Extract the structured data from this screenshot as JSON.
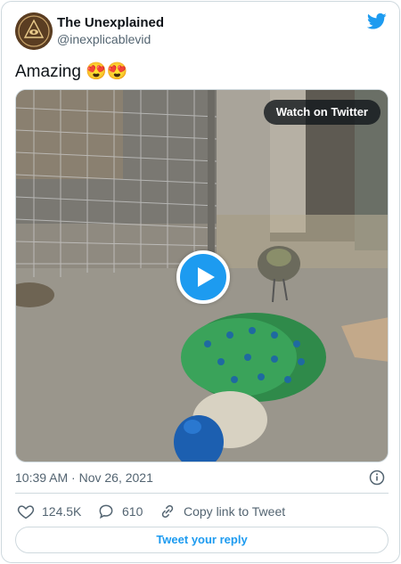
{
  "colors": {
    "accent": "#1d9bf0",
    "secondary_text": "#536471",
    "border": "#cfd9de"
  },
  "author": {
    "name": "The Unexplained",
    "handle": "@inexplicablevid",
    "avatar_icon": "eye-of-providence-logo"
  },
  "platform_icon": "twitter-bird-icon",
  "tweet": {
    "text": "Amazing 😍😍"
  },
  "media": {
    "watch_label": "Watch on Twitter",
    "play_icon": "play-icon"
  },
  "meta": {
    "timestamp": "10:39 AM · Nov 26, 2021",
    "info_icon": "info-icon"
  },
  "actions": {
    "likes": "124.5K",
    "replies": "610",
    "copy_link": "Copy link to Tweet"
  },
  "reply_button": "Tweet your reply"
}
